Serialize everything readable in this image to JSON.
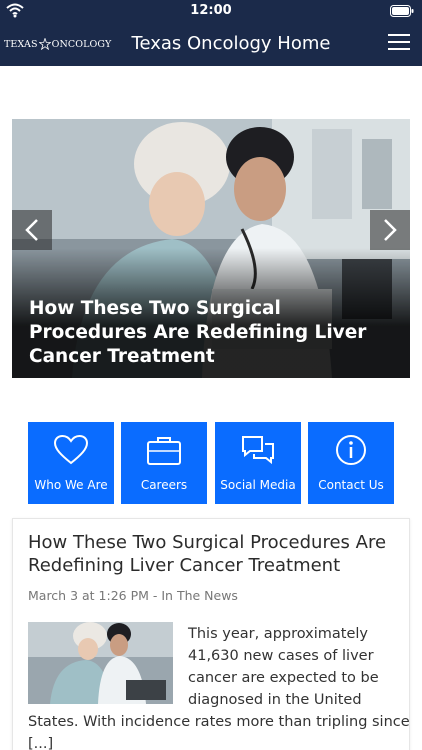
{
  "status_bar": {
    "time": "12:00"
  },
  "header": {
    "logo": {
      "left_text": "TEXAS",
      "right_text": "ONCOLOGY"
    },
    "title": "Texas Oncology Home"
  },
  "hero": {
    "caption": "How These Two Surgical Procedures Are Redefining Liver Cancer Treatment"
  },
  "quick_links": [
    {
      "label": "Who We Are",
      "icon": "heart-icon"
    },
    {
      "label": "Careers",
      "icon": "briefcase-icon"
    },
    {
      "label": "Social Media",
      "icon": "chat-bubbles-icon"
    },
    {
      "label": "Contact Us",
      "icon": "info-icon"
    }
  ],
  "article": {
    "title": "How These Two Surgical Procedures Are Redefining Liver Cancer Treatment",
    "meta": "March 3 at 1:26 PM - In The News",
    "excerpt_side": "This year, approximately 41,630 new cases of liver cancer are expected to be diagnosed in the United",
    "excerpt_full": "States. With incidence rates more than tripling since",
    "excerpt_tail": "[...]"
  },
  "colors": {
    "header_bg": "#1b2a4a",
    "tile_bg": "#0a6cff",
    "white": "#ffffff"
  }
}
